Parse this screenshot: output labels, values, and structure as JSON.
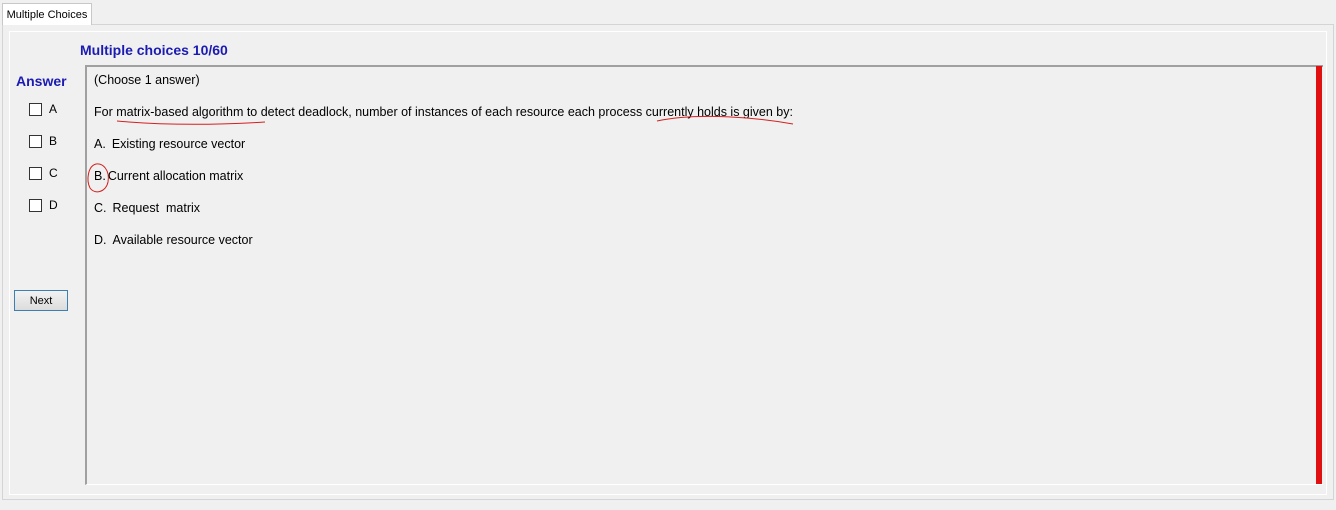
{
  "tab": {
    "label": "Multiple Choices"
  },
  "header": {
    "title": "Multiple choices 10/60"
  },
  "answer_panel": {
    "label": "Answer",
    "options": [
      "A",
      "B",
      "C",
      "D"
    ],
    "next_label": "Next"
  },
  "question": {
    "instruction": "(Choose 1 answer)",
    "text": "For matrix-based algorithm to detect deadlock, number of instances of each resource each process currently holds is given by:",
    "options": [
      {
        "letter": "A.",
        "text": "Existing resource vector"
      },
      {
        "letter": "B.",
        "text": "Current allocation matrix"
      },
      {
        "letter": "C.",
        "text": "Request  matrix"
      },
      {
        "letter": "D.",
        "text": "Available resource vector"
      }
    ]
  },
  "colors": {
    "title_blue": "#1b1bb3",
    "red_bar": "#e01010",
    "annotation_red": "#d42020"
  }
}
